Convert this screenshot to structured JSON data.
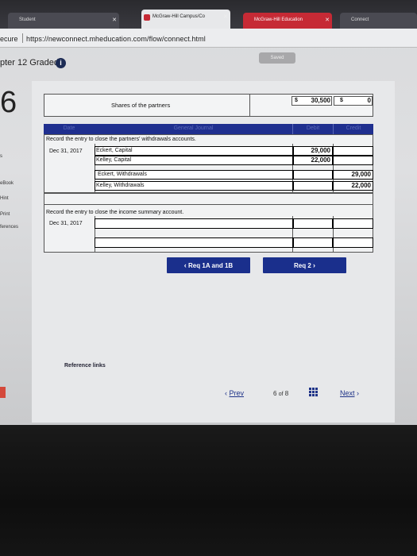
{
  "browser": {
    "tabs": [
      {
        "label": "Student",
        "active": false
      },
      {
        "label": "McGraw-Hill Campus/Co",
        "active": true
      },
      {
        "label": "McGraw-Hill Education",
        "active": false
      },
      {
        "label": "Connect",
        "active": false
      }
    ],
    "secure_label": "ecure",
    "url": "https://newconnect.mheducation.com/flow/connect.html"
  },
  "header": {
    "chapter_title": "pter 12 Graded",
    "info_icon": "info-icon",
    "saved_label": "Saved"
  },
  "question_number": "6",
  "left_rail": {
    "items": [
      "s",
      "eBook",
      "Hint",
      "Print",
      "ferences"
    ]
  },
  "shares_row": {
    "label": "Shares of the partners",
    "value1_prefix": "$",
    "value1": "30,500",
    "value2_prefix": "$",
    "value2": "0"
  },
  "journal": {
    "col_date": "Date",
    "col_general_journal": "General Journal",
    "col_debit": "Debit",
    "col_credit": "Credit",
    "entry1_instruction": "Record the entry to close the partners' withdrawals accounts.",
    "entry1_date": "Dec 31, 2017",
    "entry1_rows": [
      {
        "account": "Eckert, Capital",
        "debit": "29,000",
        "credit": ""
      },
      {
        "account": "Kelley, Capital",
        "debit": "22,000",
        "credit": ""
      },
      {
        "account": "Eckert, Withdrawals",
        "debit": "",
        "credit": "29,000"
      },
      {
        "account": "Kelley, Withdrawals",
        "debit": "",
        "credit": "22,000"
      }
    ],
    "entry2_instruction": "Record the entry to close the income summary account.",
    "entry2_date": "Dec 31, 2017"
  },
  "nav_buttons": {
    "prev_req": "Req 1A and 1B",
    "next_req": "Req 2"
  },
  "reference_links": "Reference links",
  "pager": {
    "prev": "Prev",
    "current": "6",
    "of": "of",
    "total": "8",
    "next": "Next"
  },
  "colors": {
    "header_blue": "#1f2f8f",
    "button_blue": "#1a2f8c",
    "link_blue": "#1f3388"
  }
}
